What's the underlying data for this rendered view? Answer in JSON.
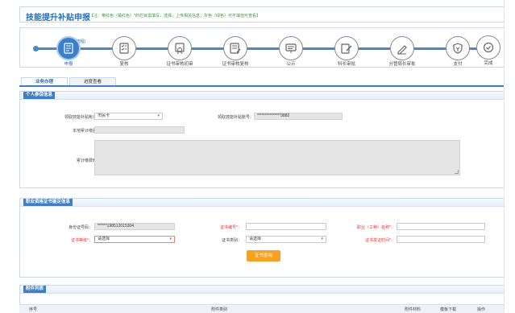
{
  "header": {
    "title": "技能提升补贴申报",
    "note_prefix": "【注：带红色（橘红色）",
    "note_star": "*",
    "note_suffix": "的栏目需填写，选择，上传相关信息；灰色（绿色）可不填但可查看】"
  },
  "stepper": {
    "current_tag": "(当前流程)",
    "steps": [
      {
        "label": "申报",
        "icon": "form-icon"
      },
      {
        "label": "复核",
        "icon": "checklist-icon"
      },
      {
        "label": "证书审核初审",
        "icon": "certificate-review-icon"
      },
      {
        "label": "证书审核复核",
        "icon": "document-edit-icon"
      },
      {
        "label": "公示",
        "icon": "notice-board-icon"
      },
      {
        "label": "科长审批",
        "icon": "pen-approve-icon"
      },
      {
        "label": "分管局长审批",
        "icon": "pen-approve-icon"
      },
      {
        "label": "支付",
        "icon": "payment-shield-icon"
      },
      {
        "label": "完成",
        "icon": "check-circle-icon"
      }
    ],
    "active_index": 0,
    "accent_color": "#3a7fc7"
  },
  "tabs": [
    {
      "label": "业务办理",
      "active": true
    },
    {
      "label": "进度查看",
      "active": false
    }
  ],
  "personal": {
    "section_title": "个人参保信息",
    "account_type_label": "领取技能补贴账户类型：",
    "account_type_value": "市民卡",
    "account_no_label": "领取技能补贴账号：",
    "account_no_value": "***************3882",
    "local_months_label": "本地累计缴费月数：",
    "local_months_value": "",
    "cumulative_time_label": "累计缴费时间段："
  },
  "certificate": {
    "section_title": "职业资格证书鉴定信息",
    "id_label": "身份证号码：",
    "id_value": "******198512015304",
    "cert_no_label": "证书编号*：",
    "occupation_label": "职业（工种）名称*：",
    "level_label": "证书等级*：",
    "level_value": "请选择",
    "cert_type_label": "证书类别：",
    "cert_type_value": "请选择",
    "issue_date_label": "证书发证时间*：",
    "query_button": "证书查询"
  },
  "attachments": {
    "section_title": "附件列表",
    "columns": [
      "序号",
      "附件类别",
      "附件材料",
      "模板下载",
      "操作"
    ]
  }
}
